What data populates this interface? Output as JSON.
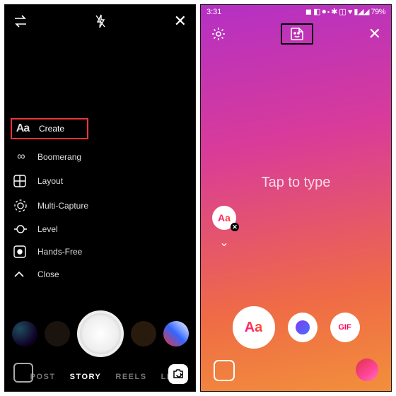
{
  "left": {
    "menu": {
      "create": "Create",
      "boomerang": "Boomerang",
      "layout": "Layout",
      "multi": "Multi-Capture",
      "level": "Level",
      "hands": "Hands-Free",
      "close": "Close"
    },
    "modes": {
      "post": "POST",
      "story": "STORY",
      "reels": "REELS",
      "live": "LI"
    }
  },
  "right": {
    "status": {
      "time": "3:31",
      "battery": "79%",
      "icons": "◼ ◧ ⏺ ⬝ ✱ ◫ ♥ ▮◢◢"
    },
    "tap": "Tap to type",
    "aa": "Aa",
    "gif": "GIF"
  }
}
